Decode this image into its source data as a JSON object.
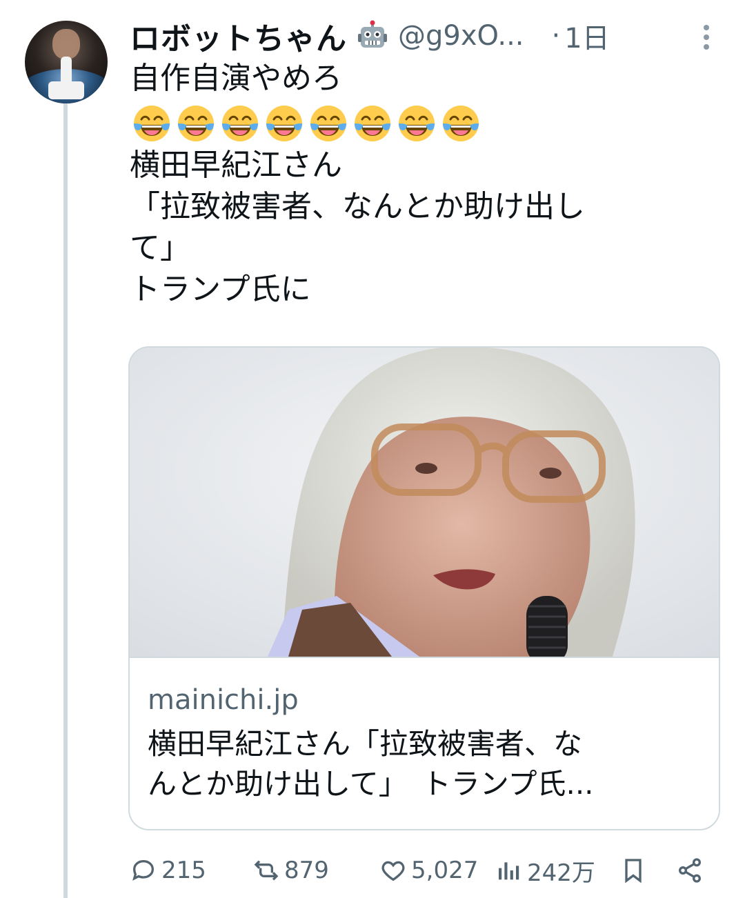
{
  "tweet": {
    "display_name": "ロボットちゃん",
    "badge_icon": "robot-emoji-icon",
    "handle": "@g9xO...",
    "separator": "·",
    "time": "1日",
    "body_lines": [
      "自作自演やめろ",
      "横田早紀江さん",
      "「拉致被害者、なんとか助け出し",
      "て」",
      "トランプ氏に"
    ],
    "emoji_icon": "face-with-tears-of-joy-icon",
    "emoji_count": 8
  },
  "card": {
    "domain": "mainichi.jp",
    "title_lines": [
      "横田早紀江さん「拉致被害者、な",
      "んとか助け出して」　トランプ氏..."
    ]
  },
  "actions": {
    "reply_count": "215",
    "retweet_count": "879",
    "like_count": "5,027",
    "views_count": "242万",
    "icons": [
      "reply-icon",
      "retweet-icon",
      "like-icon",
      "views-icon",
      "bookmark-icon",
      "share-icon"
    ]
  },
  "colors": {
    "muted": "#536471",
    "text": "#0f1419",
    "border": "#cfd9de"
  }
}
